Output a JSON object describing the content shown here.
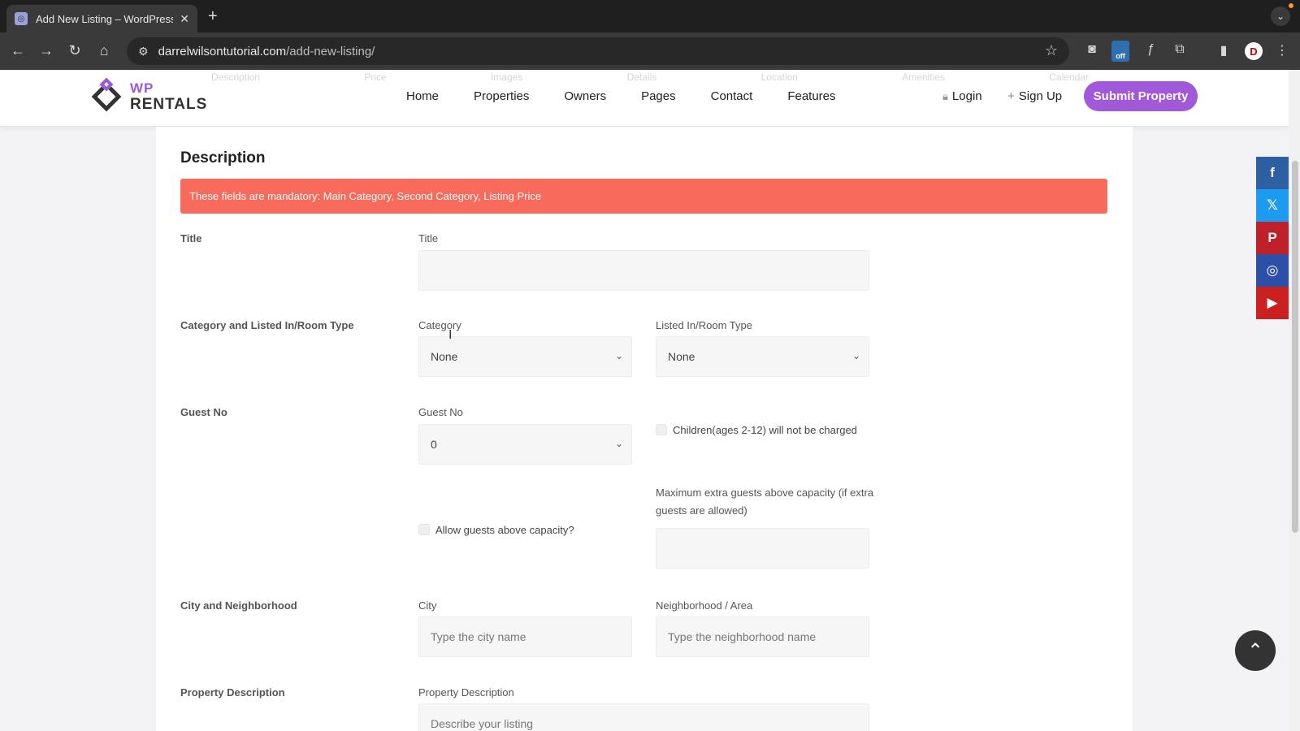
{
  "browser": {
    "tab_title": "Add New Listing – WordPress",
    "url_domain": "darrelwilsontutorial.com",
    "url_path": "/add-new-listing/",
    "ext_off_label": "off",
    "profile_initial": "D"
  },
  "header": {
    "ghost_items": [
      "Description",
      "Price",
      "Images",
      "Details",
      "Location",
      "Amenities",
      "Calendar"
    ],
    "logo_wp": "WP",
    "logo_rentals": "RENTALS",
    "nav": [
      "Home",
      "Properties",
      "Owners",
      "Pages",
      "Contact",
      "Features"
    ],
    "login": "Login",
    "signup": "Sign Up",
    "submit": "Submit Property"
  },
  "form": {
    "section_title": "Description",
    "alert": "These fields are mandatory: Main Category, Second Category, Listing Price",
    "title_row": "Title",
    "title_label": "Title",
    "title_value": "",
    "category_row": "Category and Listed In/Room Type",
    "category_label": "Category",
    "category_value": "None",
    "room_type_label": "Listed In/Room Type",
    "room_type_value": "None",
    "guest_row": "Guest No",
    "guest_label": "Guest No",
    "guest_value": "0",
    "children_label": "Children(ages 2-12) will not be charged",
    "max_extra_label": "Maximum extra guests above capacity (if extra guests are allowed)",
    "max_extra_value": "",
    "allow_above_label": "Allow guests above capacity?",
    "city_row": "City and Neighborhood",
    "city_label": "City",
    "city_placeholder": "Type the city name",
    "neighborhood_label": "Neighborhood / Area",
    "neighborhood_placeholder": "Type the neighborhood name",
    "desc_row": "Property Description",
    "desc_label": "Property Description",
    "desc_placeholder": "Describe your listing"
  },
  "social": [
    "facebook-icon",
    "x-icon",
    "pinterest-icon",
    "instagram-icon",
    "youtube-icon"
  ],
  "colors": {
    "accent": "#a259d9",
    "alert": "#f76a5c"
  }
}
